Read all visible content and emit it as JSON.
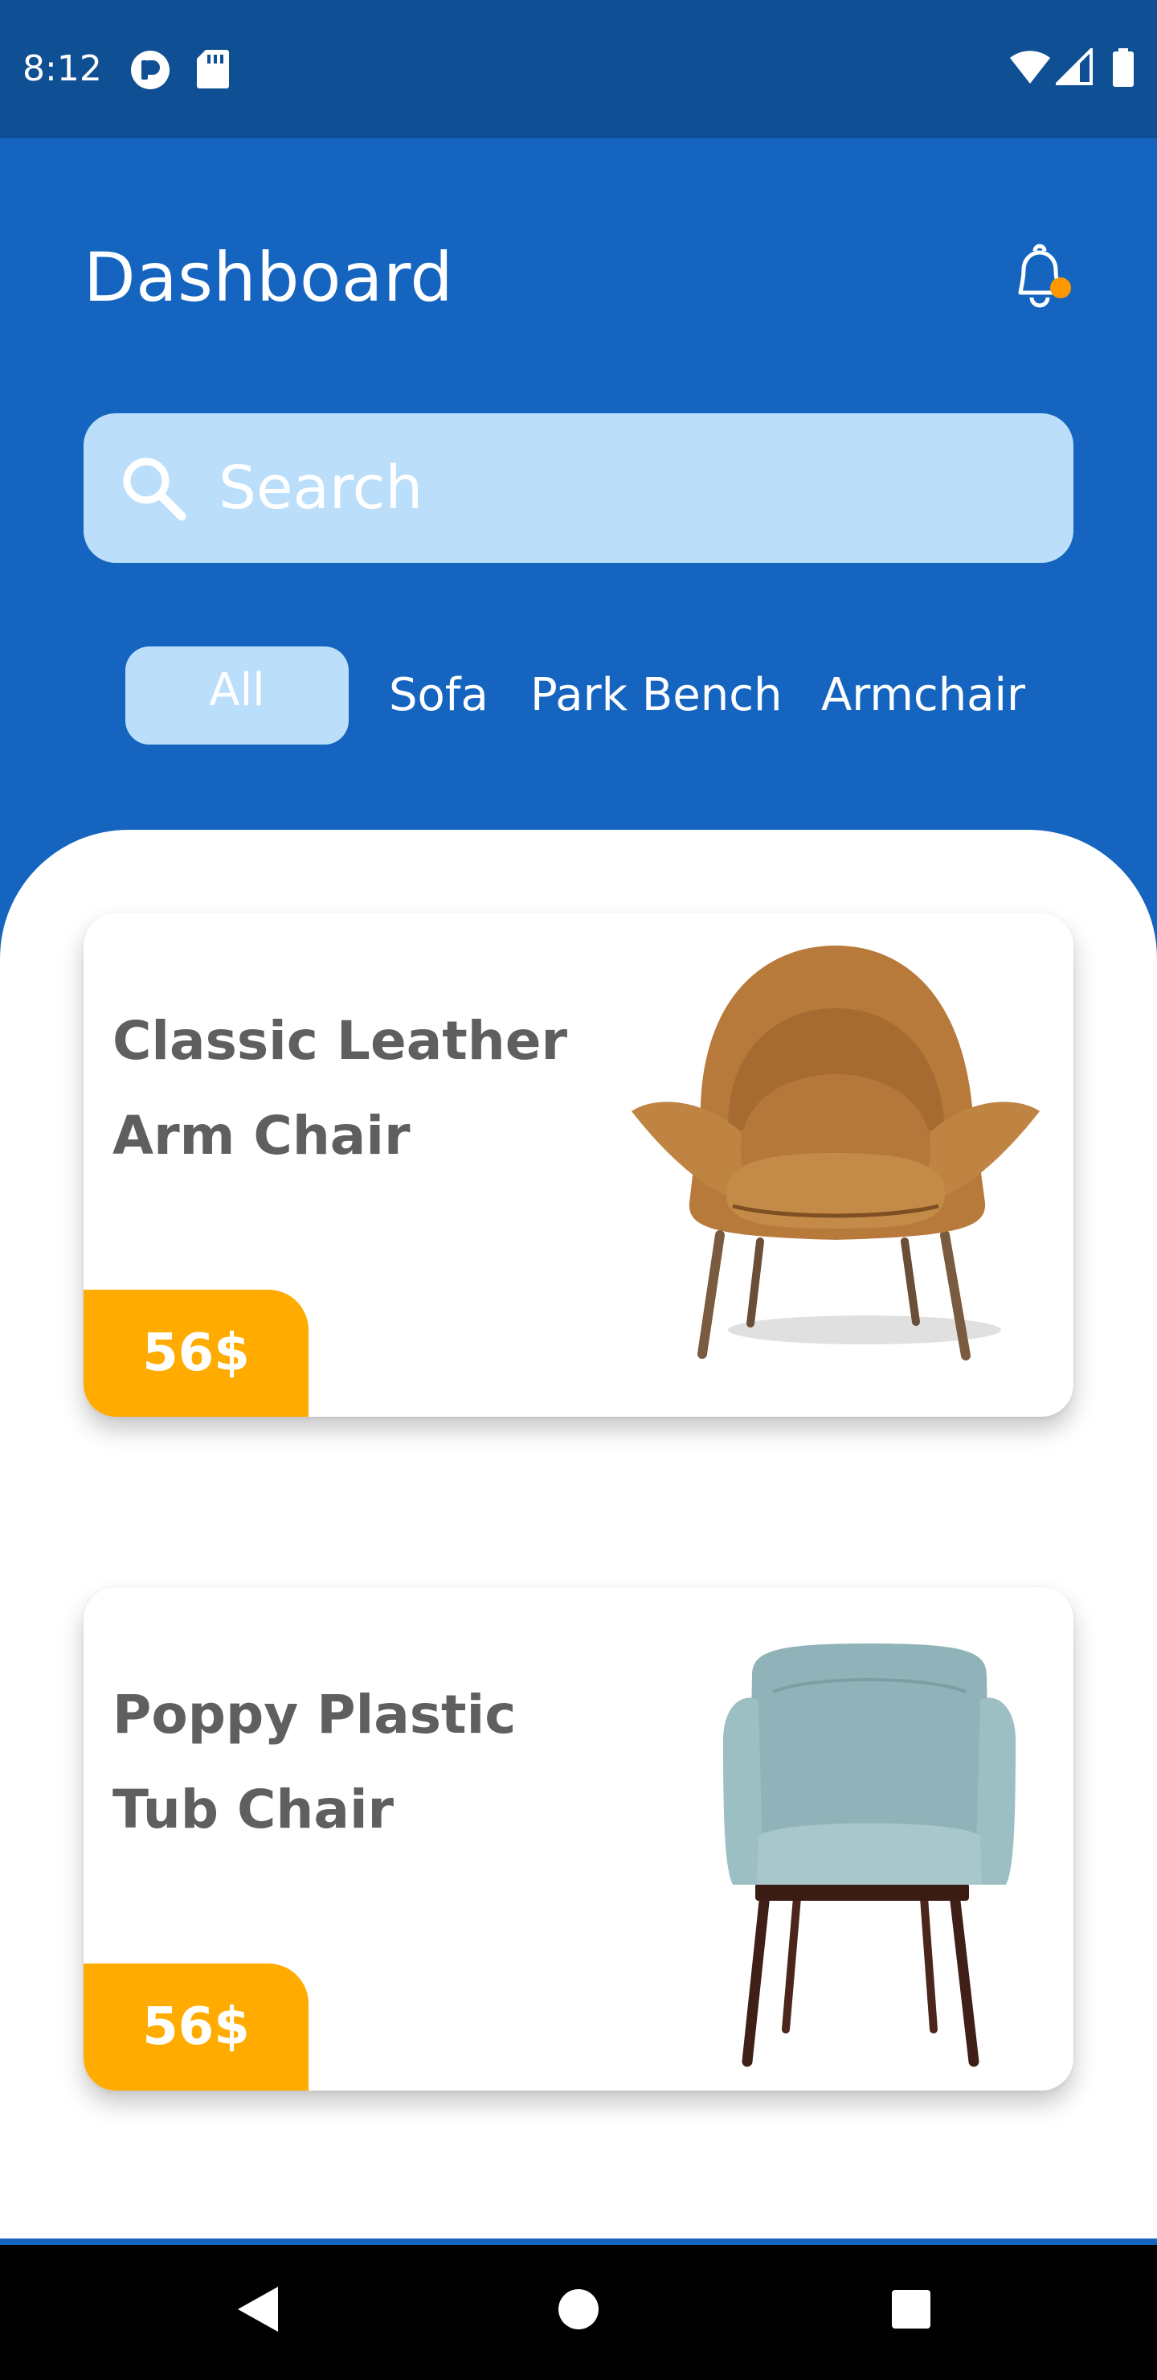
{
  "status_bar": {
    "time": "8:12",
    "left_icons": [
      "pocket-icon",
      "sd-card-icon"
    ],
    "right_icons": [
      "wifi-icon",
      "signal-icon",
      "battery-icon"
    ]
  },
  "header": {
    "title": "Dashboard",
    "notification_icon": "bell-icon",
    "notification_dot_color": "#ff9800"
  },
  "search": {
    "placeholder": "Search",
    "value": ""
  },
  "categories": {
    "active": "All",
    "items": [
      "All",
      "Sofa",
      "Park Bench",
      "Armchair"
    ]
  },
  "products": [
    {
      "title_line1": "Classic Leather",
      "title_line2": "Arm Chair",
      "price": "56$",
      "image": "mustard-armchair"
    },
    {
      "title_line1": "Poppy Plastic",
      "title_line2": "Tub Chair",
      "price": "56$",
      "image": "teal-tub-chair"
    }
  ],
  "colors": {
    "primary": "#1565c0",
    "status_bar": "#0f4f93",
    "search_bg": "#bbdefb",
    "price_tag": "#ffab00",
    "card_title": "#5f5f5f"
  },
  "nav": [
    "back-icon",
    "home-icon",
    "recents-icon"
  ]
}
